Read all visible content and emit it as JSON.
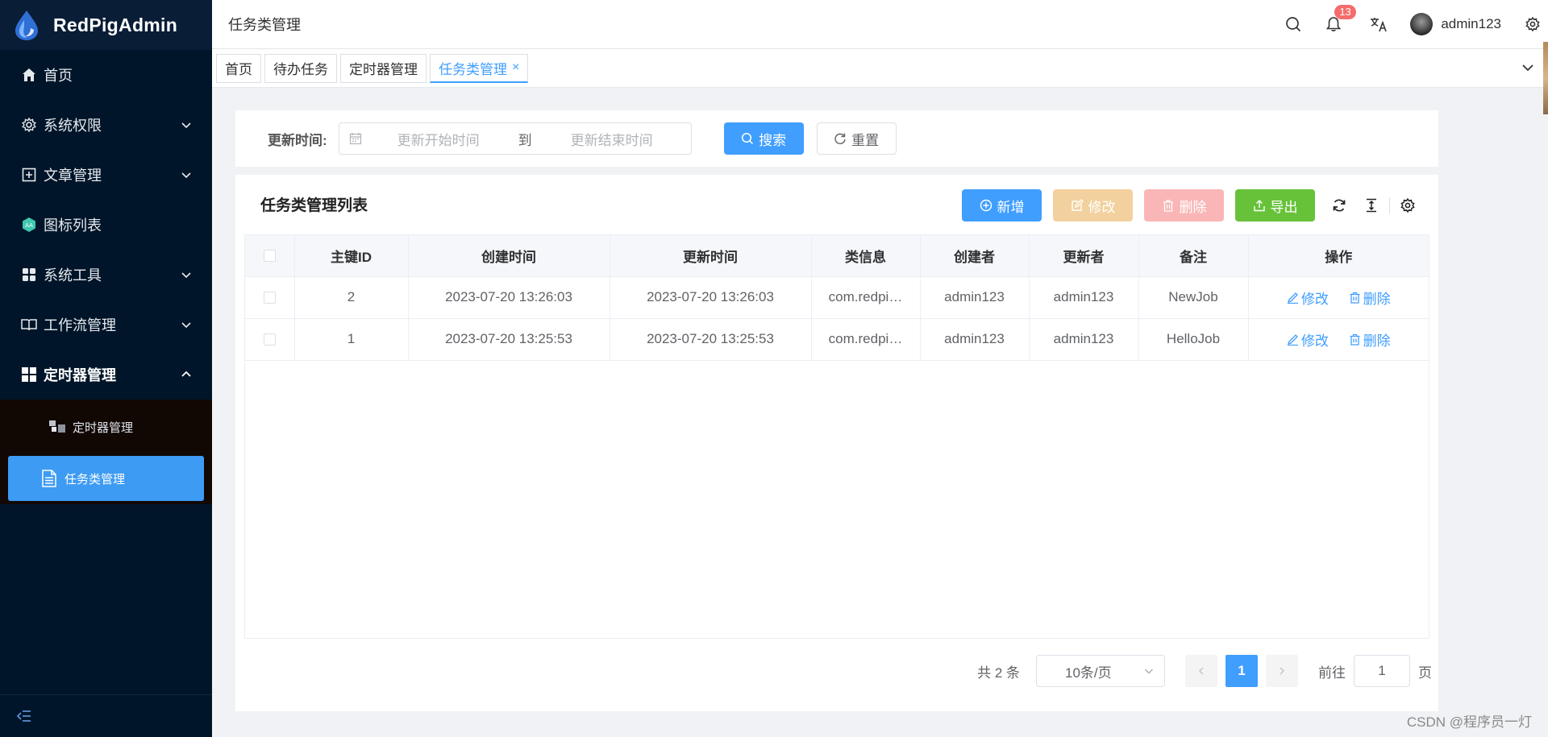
{
  "app": {
    "name": "RedPigAdmin",
    "watermark": "CSDN @程序员一灯"
  },
  "sidebar": {
    "items": [
      {
        "label": "首页",
        "icon": "home-icon",
        "has_children": false
      },
      {
        "label": "系统权限",
        "icon": "gear-icon",
        "has_children": true
      },
      {
        "label": "文章管理",
        "icon": "plus-square-icon",
        "has_children": true
      },
      {
        "label": "图标列表",
        "icon": "tag-icon",
        "has_children": false
      },
      {
        "label": "系统工具",
        "icon": "grid-icon",
        "has_children": true
      },
      {
        "label": "工作流管理",
        "icon": "book-icon",
        "has_children": true
      },
      {
        "label": "定时器管理",
        "icon": "dashboard-icon",
        "has_children": true,
        "expanded": true
      }
    ],
    "sub_items": [
      {
        "label": "定时器管理",
        "icon": "blocks-icon",
        "active": false
      },
      {
        "label": "任务类管理",
        "icon": "document-icon",
        "active": true
      }
    ]
  },
  "header": {
    "breadcrumb": "任务类管理",
    "notification_count": "13",
    "username": "admin123"
  },
  "tabs": [
    {
      "label": "首页",
      "active": false
    },
    {
      "label": "待办任务",
      "active": false
    },
    {
      "label": "定时器管理",
      "active": false
    },
    {
      "label": "任务类管理",
      "active": true
    }
  ],
  "search": {
    "label": "更新时间:",
    "start_placeholder": "更新开始时间",
    "separator": "到",
    "end_placeholder": "更新结束时间",
    "search_button": "搜索",
    "reset_button": "重置"
  },
  "list": {
    "title": "任务类管理列表",
    "toolbar": {
      "add": "新增",
      "edit": "修改",
      "delete": "删除",
      "export": "导出"
    },
    "columns": [
      "主键ID",
      "创建时间",
      "更新时间",
      "类信息",
      "创建者",
      "更新者",
      "备注",
      "操作"
    ],
    "rows": [
      {
        "id": "2",
        "created": "2023-07-20 13:26:03",
        "updated": "2023-07-20 13:26:03",
        "class_info": "com.redpi…",
        "creator": "admin123",
        "updater": "admin123",
        "remark": "NewJob"
      },
      {
        "id": "1",
        "created": "2023-07-20 13:25:53",
        "updated": "2023-07-20 13:25:53",
        "class_info": "com.redpi…",
        "creator": "admin123",
        "updater": "admin123",
        "remark": "HelloJob"
      }
    ],
    "row_actions": {
      "edit": "修改",
      "delete": "删除"
    }
  },
  "pagination": {
    "total": "共 2 条",
    "page_size": "10条/页",
    "current_page": "1",
    "goto_label": "前往",
    "goto_value": "1",
    "page_suffix": "页"
  },
  "colors": {
    "primary": "#409eff",
    "sidebar_bg": "#001529",
    "success": "#67c23a",
    "warning_light": "#f3d19e",
    "danger_light": "#fab6b6",
    "badge": "#f56c6c"
  }
}
